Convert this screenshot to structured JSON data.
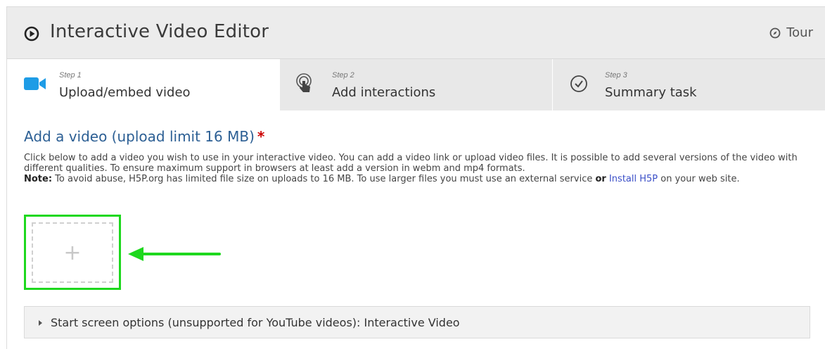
{
  "header": {
    "title": "Interactive Video Editor",
    "tour_label": "Tour"
  },
  "steps": [
    {
      "number": "Step 1",
      "label": "Upload/embed video",
      "icon": "video-camera-icon",
      "active": true
    },
    {
      "number": "Step 2",
      "label": "Add interactions",
      "icon": "touch-pointer-icon",
      "active": false
    },
    {
      "number": "Step 3",
      "label": "Summary task",
      "icon": "checkmark-circle-icon",
      "active": false
    }
  ],
  "field": {
    "title": "Add a video (upload limit 16 MB)",
    "required_mark": "*",
    "description": "Click below to add a video you wish to use in your interactive video. You can add a video link or upload video files. It is possible to add several versions of the video with different qualities. To ensure maximum support in browsers at least add a version in webm and mp4 formats.",
    "note_label": "Note:",
    "note_text_1": " To avoid abuse, H5P.org has limited file size on uploads to 16 MB. To use larger files you must use an external service ",
    "note_or": "or",
    "note_link": "Install H5P",
    "note_text_2": " on your web site."
  },
  "upload": {
    "plus": "+"
  },
  "start_screen": {
    "label": "Start screen options (unsupported for YouTube videos): Interactive Video"
  },
  "colors": {
    "accent_blue": "#2c5f94",
    "camera_blue": "#1e9ce6",
    "highlight_green": "#1ed81e",
    "required_red": "#cc0000",
    "link_blue": "#3b4fc7"
  }
}
